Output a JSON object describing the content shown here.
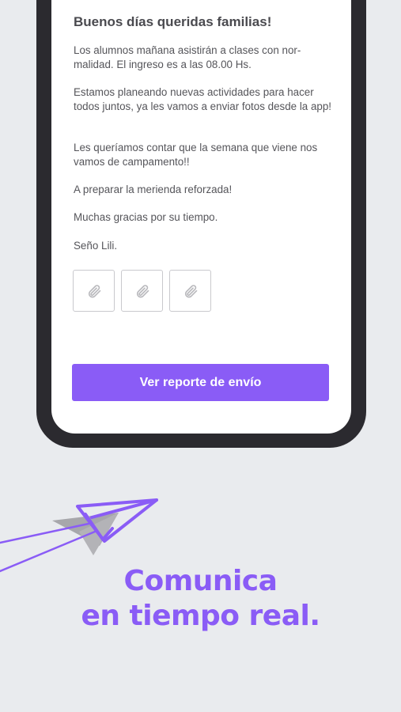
{
  "message": {
    "title": "Buenos días queridas familias!",
    "paragraphs": [
      "Los alumnos mañana asistirán a clases con nor-malidad. El ingreso es a las 08.00 Hs.",
      "Estamos planeando nuevas actividades para hacer todos juntos, ya les vamos a enviar fotos desde la app!",
      "Les queríamos contar que la semana que viene nos vamos de campamento!!",
      "A preparar la merienda reforzada!",
      "Muchas gracias por su tiempo.",
      "Seño Lili."
    ],
    "attachment_icons": [
      "paperclip-icon",
      "paperclip-icon",
      "paperclip-icon"
    ]
  },
  "actions": {
    "report_label": "Ver reporte de envío"
  },
  "headline": {
    "line1": "Comunica",
    "line2": "en tiempo real."
  },
  "colors": {
    "accent": "#8a5cf6",
    "background": "#e9ebee",
    "phone_frame": "#2b2a2f"
  }
}
